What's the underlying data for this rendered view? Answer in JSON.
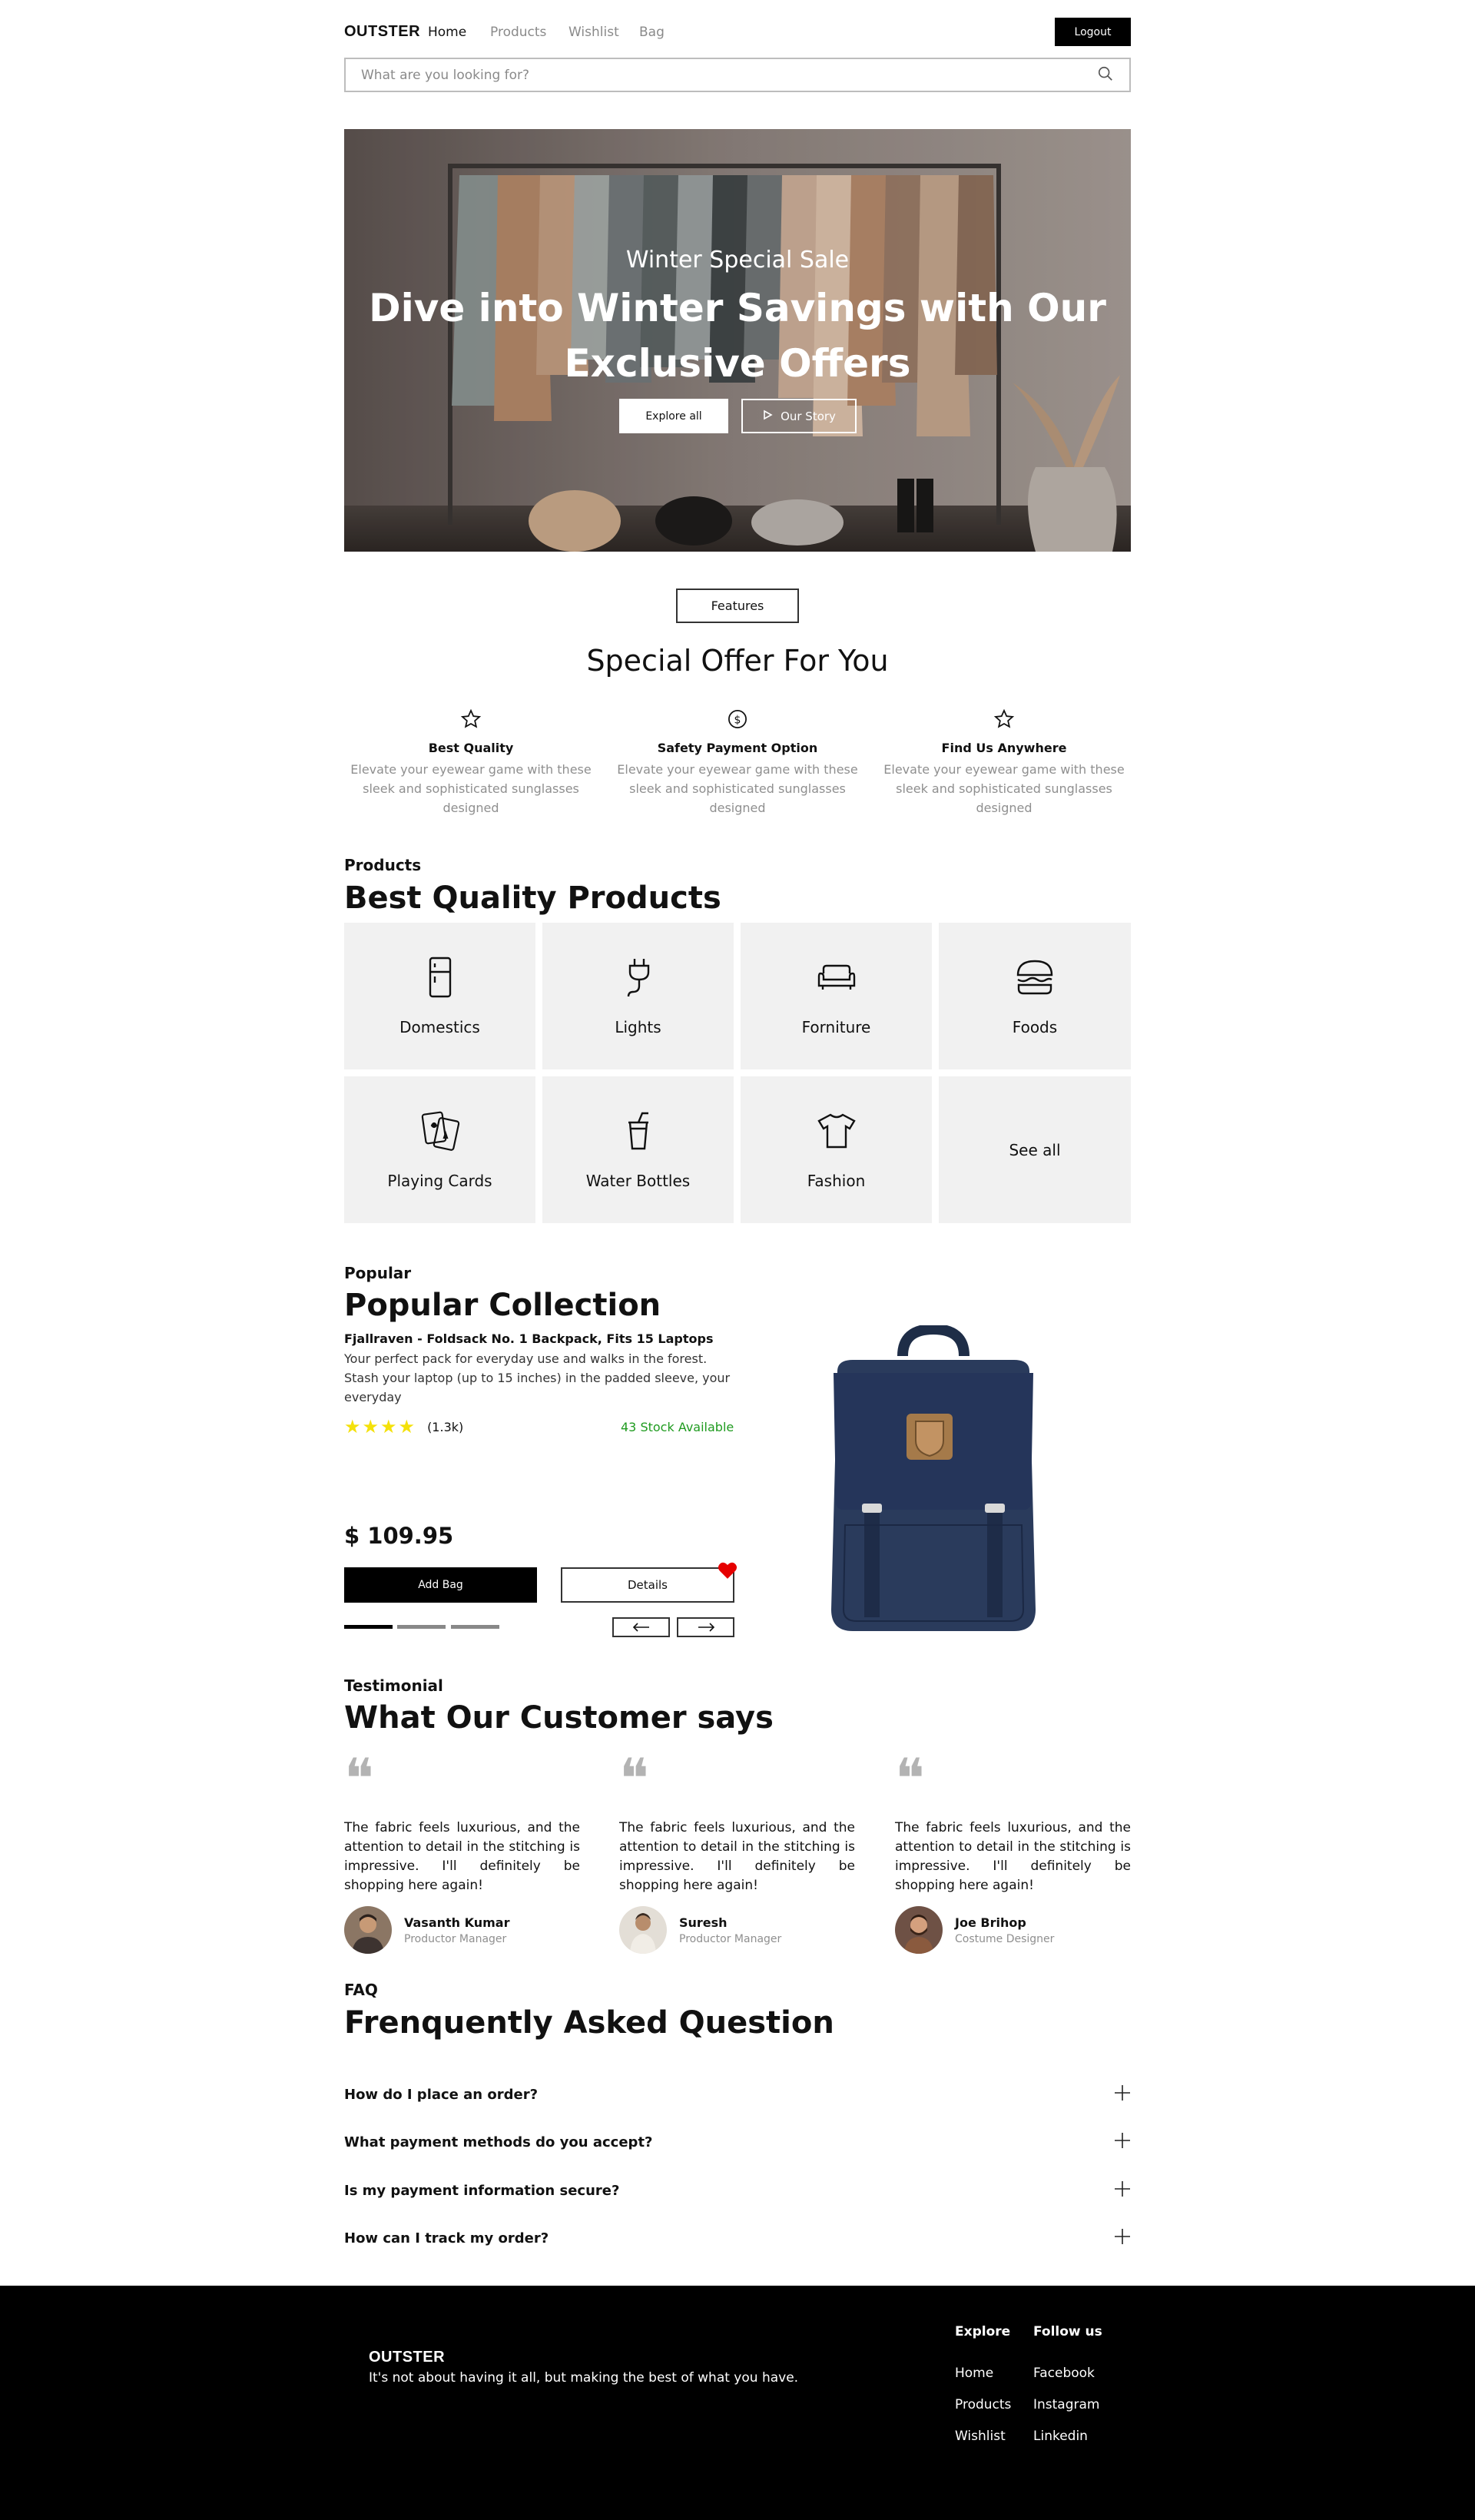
{
  "header": {
    "logo": "OUTSTER",
    "nav": [
      {
        "label": "Home",
        "active": true
      },
      {
        "label": "Products",
        "active": false
      },
      {
        "label": "Wishlist",
        "active": false
      },
      {
        "label": "Bag",
        "active": false
      }
    ],
    "logout_label": "Logout",
    "search_placeholder": "What are you looking for?",
    "search_icon": "search-icon"
  },
  "hero": {
    "subtitle": "Winter Special Sale",
    "title_line1": "Dive into Winter Savings with Our",
    "title_line2": "Exclusive Offers",
    "explore_label": "Explore all",
    "story_label": "Our Story",
    "story_icon": "play-icon"
  },
  "features": {
    "pill_label": "Features",
    "title": "Special Offer For You",
    "items": [
      {
        "icon": "star-icon",
        "title": "Best Quality",
        "desc": "Elevate your eyewear game with these sleek and sophisticated sunglasses designed"
      },
      {
        "icon": "dollar-icon",
        "title": "Safety Payment Option",
        "desc": "Elevate your eyewear game with these sleek and sophisticated sunglasses designed"
      },
      {
        "icon": "star-icon",
        "title": "Find Us Anywhere",
        "desc": "Elevate your eyewear game with these sleek and sophisticated sunglasses designed"
      }
    ]
  },
  "products": {
    "eyebrow": "Products",
    "title": "Best Quality Products",
    "categories": [
      {
        "label": "Domestics",
        "icon": "fridge-icon"
      },
      {
        "label": "Lights",
        "icon": "plug-icon"
      },
      {
        "label": "Forniture",
        "icon": "sofa-icon"
      },
      {
        "label": "Foods",
        "icon": "burger-icon"
      },
      {
        "label": "Playing Cards",
        "icon": "cards-icon"
      },
      {
        "label": "Water Bottles",
        "icon": "cup-icon"
      },
      {
        "label": "Fashion",
        "icon": "tshirt-icon"
      },
      {
        "label": "See all",
        "icon": ""
      }
    ]
  },
  "popular": {
    "eyebrow": "Popular",
    "title": "Popular Collection",
    "product_name": "Fjallraven - Foldsack No. 1 Backpack, Fits 15 Laptops",
    "product_desc": "Your perfect pack for everyday use and walks in the forest. Stash your laptop (up to 15 inches) in the padded sleeve, your everyday",
    "rating_stars": 4,
    "rating_count": "(1.3k)",
    "stock": "43 Stock Available",
    "price": "$ 109.95",
    "add_label": "Add Bag",
    "details_label": "Details",
    "slide_index": 1,
    "slide_count": 3
  },
  "testimonials": {
    "eyebrow": "Testimonial",
    "title": "What Our Customer says",
    "items": [
      {
        "text": "The fabric feels luxurious, and the attention to detail in the stitching is impressive. I'll definitely be shopping here again!",
        "name": "Vasanth Kumar",
        "role": "Productor Manager"
      },
      {
        "text": "The fabric feels luxurious, and the attention to detail in the stitching is impressive. I'll definitely be shopping here again!",
        "name": "Suresh",
        "role": "Productor Manager"
      },
      {
        "text": "The fabric feels luxurious, and the attention to detail in the stitching is impressive. I'll definitely be shopping here again!",
        "name": "Joe Brihop",
        "role": "Costume Designer"
      }
    ]
  },
  "faq": {
    "eyebrow": "FAQ",
    "title": "Frenquently Asked Question",
    "items": [
      {
        "q": "How do I place an order?"
      },
      {
        "q": "What payment methods do you accept?"
      },
      {
        "q": "Is my payment information secure?"
      },
      {
        "q": "How can I track my order?"
      }
    ]
  },
  "footer": {
    "logo": "OUTSTER",
    "tagline": "It's not about having it all, but making the best of what you have.",
    "explore_title": "Explore",
    "explore_links": [
      "Home",
      "Products",
      "Wishlist"
    ],
    "follow_title": "Follow us",
    "follow_links": [
      "Facebook",
      "Instagram",
      "Linkedin"
    ]
  },
  "colors": {
    "accent": "#000000",
    "stock_green": "#1f9b1f",
    "star_yellow": "#f4e10a",
    "heart_red": "#e60000",
    "tile_bg": "#f1f1f1"
  }
}
